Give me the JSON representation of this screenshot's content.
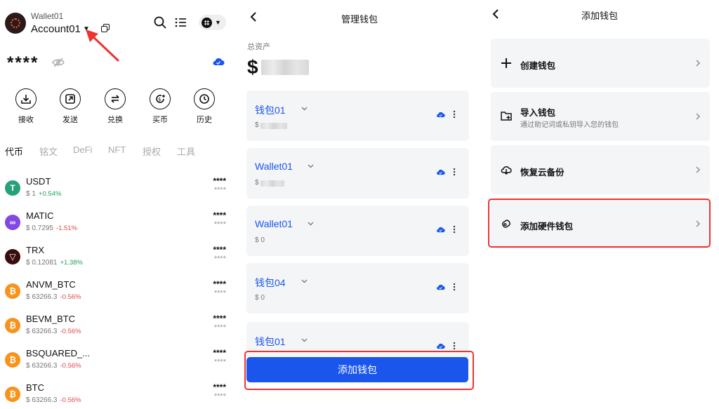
{
  "panel1": {
    "wallet_name": "Wallet01",
    "account_name": "Account01",
    "balance_masked": "****",
    "actions": [
      {
        "label": "接收",
        "icon": "receive-icon"
      },
      {
        "label": "发送",
        "icon": "send-icon"
      },
      {
        "label": "兑换",
        "icon": "swap-icon"
      },
      {
        "label": "买币",
        "icon": "buy-icon"
      },
      {
        "label": "历史",
        "icon": "history-icon"
      }
    ],
    "tabs": [
      "代币",
      "铭文",
      "DeFi",
      "NFT",
      "授权",
      "工具"
    ],
    "tokens": [
      {
        "symbol": "USDT",
        "price": "$ 1",
        "change": "+0.54%",
        "dir": "pos",
        "balance": "****",
        "value": "****",
        "color": "#26a17b",
        "glyph": "T"
      },
      {
        "symbol": "MATIC",
        "price": "$ 0.7295",
        "change": "-1.51%",
        "dir": "neg",
        "balance": "****",
        "value": "****",
        "color": "#8247e5",
        "glyph": "∞"
      },
      {
        "symbol": "TRX",
        "price": "$ 0.12081",
        "change": "+1.38%",
        "dir": "pos",
        "balance": "****",
        "value": "****",
        "color": "#3a0d0d",
        "glyph": "▽"
      },
      {
        "symbol": "ANVM_BTC",
        "price": "$ 63266.3",
        "change": "-0.56%",
        "dir": "neg",
        "balance": "****",
        "value": "****",
        "color": "#f7931a",
        "glyph": "₿"
      },
      {
        "symbol": "BEVM_BTC",
        "price": "$ 63266.3",
        "change": "-0.56%",
        "dir": "neg",
        "balance": "****",
        "value": "****",
        "color": "#f7931a",
        "glyph": "₿"
      },
      {
        "symbol": "BSQUARED_...",
        "price": "$ 63266.3",
        "change": "-0.56%",
        "dir": "neg",
        "balance": "****",
        "value": "****",
        "color": "#f7931a",
        "glyph": "₿"
      },
      {
        "symbol": "BTC",
        "price": "$ 63266.3",
        "change": "-0.56%",
        "dir": "neg",
        "balance": "****",
        "value": "****",
        "color": "#f7931a",
        "glyph": "₿"
      }
    ]
  },
  "panel2": {
    "title": "管理钱包",
    "total_label": "总资产",
    "total_currency": "$",
    "wallets": [
      {
        "name": "钱包01",
        "value": "$",
        "blurred": true
      },
      {
        "name": "Wallet01",
        "value": "$",
        "blurred": true
      },
      {
        "name": "Wallet01",
        "value": "$ 0",
        "blurred": false
      },
      {
        "name": "钱包04",
        "value": "$ 0",
        "blurred": false
      },
      {
        "name": "钱包01",
        "value": "",
        "blurred": false
      }
    ],
    "add_button": "添加钱包"
  },
  "panel3": {
    "title": "添加钱包",
    "options": [
      {
        "title": "创建钱包",
        "subtitle": "",
        "icon": "plus-icon"
      },
      {
        "title": "导入钱包",
        "subtitle": "通过助记词或私钥导入您的钱包",
        "icon": "import-icon"
      },
      {
        "title": "恢复云备份",
        "subtitle": "",
        "icon": "cloud-download-icon"
      },
      {
        "title": "添加硬件钱包",
        "subtitle": "",
        "icon": "hardware-wallet-icon"
      }
    ]
  },
  "colors": {
    "accent": "#1a56ec",
    "highlight": "#e33333",
    "positive": "#1ea35a",
    "negative": "#e0484c"
  }
}
